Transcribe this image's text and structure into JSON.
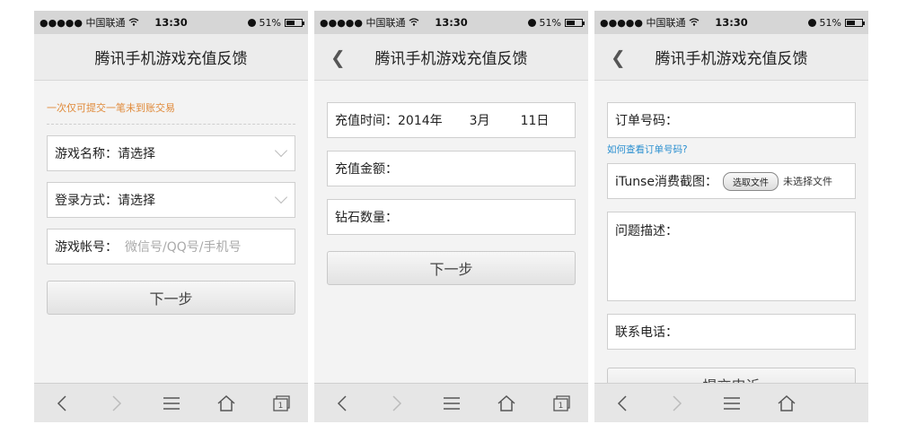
{
  "status": {
    "carrier": "●●●●● 中国联通",
    "time": "13:30",
    "battery": "51%"
  },
  "screen1": {
    "title": "腾讯手机游戏充值反馈",
    "notice": "一次仅可提交一笔未到账交易",
    "game_label": "游戏名称：请选择",
    "login_label": "登录方式：请选择",
    "account_label": "游戏帐号：",
    "account_placeholder": "微信号/QQ号/手机号",
    "next": "下一步"
  },
  "screen2": {
    "title": "腾讯手机游戏充值反馈",
    "time_label": "充值时间：",
    "year": "2014年",
    "month": "3月",
    "day": "11日",
    "amount_label": "充值金额：",
    "diamond_label": "钻石数量：",
    "next": "下一步"
  },
  "screen3": {
    "title": "腾讯手机游戏充值反馈",
    "order_label": "订单号码：",
    "help_link": "如何查看订单号码?",
    "itunes_label": "iTunse消费截图：",
    "file_button": "选取文件",
    "no_file": "未选择文件",
    "desc_label": "问题描述：",
    "phone_label": "联系电话：",
    "submit": "提交申诉"
  },
  "toolbar": {
    "tab_count": "1"
  }
}
